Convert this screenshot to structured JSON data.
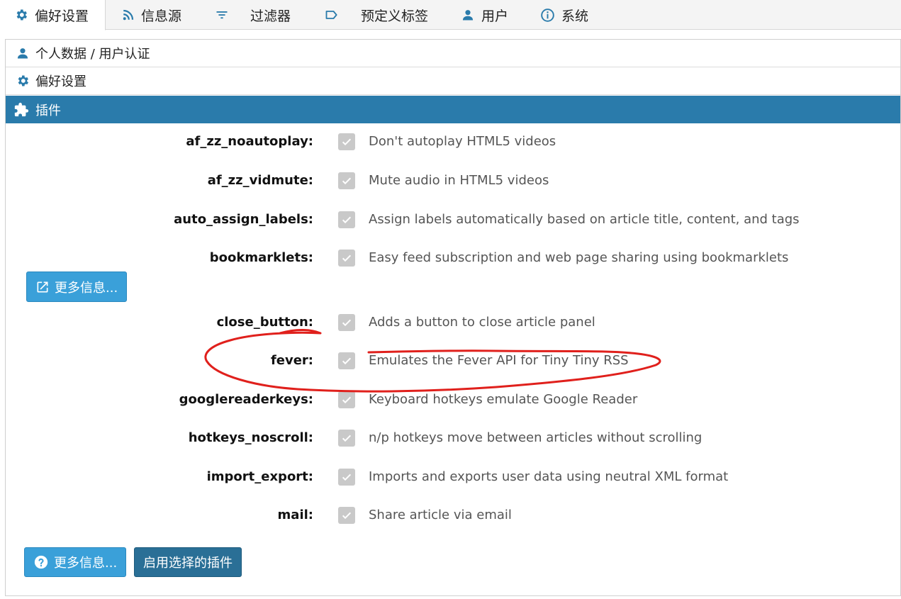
{
  "tabs": [
    {
      "label": "偏好设置",
      "icon": "gear-icon",
      "active": true
    },
    {
      "label": "信息源",
      "icon": "rss-icon",
      "active": false
    },
    {
      "label": "过滤器",
      "icon": "filter-icon",
      "active": false
    },
    {
      "label": "预定义标签",
      "icon": "label-icon",
      "active": false
    },
    {
      "label": "用户",
      "icon": "person-icon",
      "active": false
    },
    {
      "label": "系统",
      "icon": "info-icon",
      "active": false
    }
  ],
  "sections": {
    "personal": {
      "label": "个人数据 / 用户认证",
      "icon": "person-icon"
    },
    "preferences": {
      "label": "偏好设置",
      "icon": "gear-icon"
    },
    "plugins": {
      "label": "插件",
      "icon": "puzzle-icon",
      "active": true
    }
  },
  "plugins": [
    {
      "name": "af_zz_noautoplay:",
      "description": "Don't autoplay HTML5 videos",
      "checked": true
    },
    {
      "name": "af_zz_vidmute:",
      "description": "Mute audio in HTML5 videos",
      "checked": true
    },
    {
      "name": "auto_assign_labels:",
      "description": "Assign labels automatically based on article title, content, and tags",
      "checked": true
    },
    {
      "name": "bookmarklets:",
      "description": "Easy feed subscription and web page sharing using bookmarklets",
      "checked": true
    },
    {
      "name": "close_button:",
      "description": "Adds a button to close article panel",
      "checked": true
    },
    {
      "name": "fever:",
      "description": "Emulates the Fever API for Tiny Tiny RSS",
      "checked": true
    },
    {
      "name": "googlereaderkeys:",
      "description": "Keyboard hotkeys emulate Google Reader",
      "checked": true
    },
    {
      "name": "hotkeys_noscroll:",
      "description": "n/p hotkeys move between articles without scrolling",
      "checked": true
    },
    {
      "name": "import_export:",
      "description": "Imports and exports user data using neutral XML format",
      "checked": true
    },
    {
      "name": "mail:",
      "description": "Share article via email",
      "checked": true
    }
  ],
  "buttons": {
    "more_info_inline": "更多信息...",
    "more_info_bottom": "更多信息...",
    "enable_selected": "启用选择的插件"
  },
  "colors": {
    "accent": "#2a7bab",
    "info_button": "#3aa0d9",
    "primary_button": "#2a6f96",
    "annotation": "#e0201c",
    "checkbox_disabled": "#c9c9c9"
  }
}
